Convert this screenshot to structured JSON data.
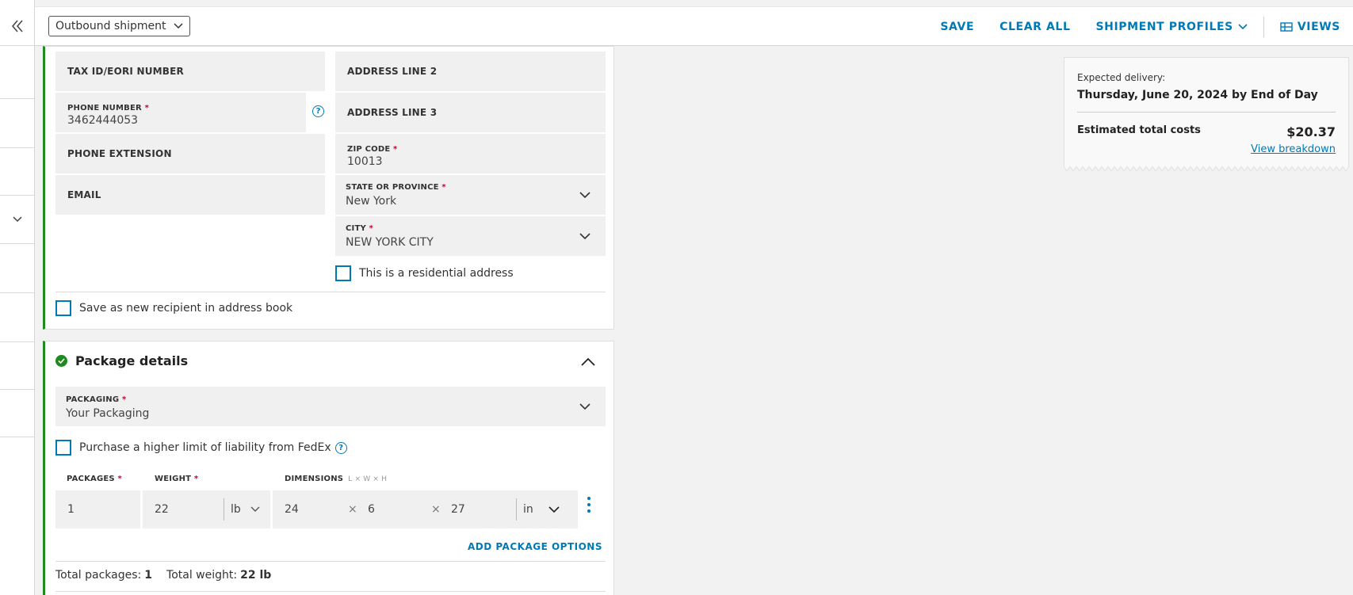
{
  "topbar": {
    "shipment_type": "Outbound shipment",
    "save": "SAVE",
    "clear_all": "CLEAR ALL",
    "shipment_profiles": "SHIPMENT PROFILES",
    "views": "VIEWS"
  },
  "recipient": {
    "tax_id_label": "TAX ID/EORI NUMBER",
    "address2_label": "ADDRESS LINE 2",
    "phone_label": "PHONE NUMBER",
    "phone_value": "3462444053",
    "address3_label": "ADDRESS LINE 3",
    "phone_ext_label": "PHONE EXTENSION",
    "zip_label": "ZIP CODE",
    "zip_value": "10013",
    "email_label": "EMAIL",
    "state_label": "STATE OR PROVINCE",
    "state_value": "New York",
    "city_label": "CITY",
    "city_value": "NEW YORK CITY",
    "residential_label": "This is a residential address",
    "save_recipient_label": "Save as new recipient in address book",
    "required_mark": "*",
    "help_glyph": "?"
  },
  "package": {
    "title": "Package details",
    "packaging_label": "PACKAGING",
    "packaging_value": "Your Packaging",
    "liability_label": "Purchase a higher limit of liability from FedEx",
    "packages_label": "PACKAGES",
    "weight_label": "WEIGHT",
    "dimensions_label": "DIMENSIONS",
    "dimensions_sub": "L × W × H",
    "packages_value": "1",
    "weight_value": "22",
    "weight_unit": "lb",
    "length_value": "24",
    "width_value": "6",
    "height_value": "27",
    "dim_unit": "in",
    "times": "×",
    "add_options": "ADD PACKAGE OPTIONS",
    "total_packages_label": "Total packages:",
    "total_packages_value": "1",
    "total_weight_label": "Total weight:",
    "total_weight_value": "22 lb"
  },
  "estimate": {
    "expected_label": "Expected delivery:",
    "expected_date": "Thursday, June 20, 2024 by End of Day",
    "total_label": "Estimated total costs",
    "total_value": "$20.37",
    "breakdown_link": "View breakdown"
  },
  "colors": {
    "accent": "#007ab7",
    "success": "#1f8a1f",
    "required": "#d1002f"
  }
}
